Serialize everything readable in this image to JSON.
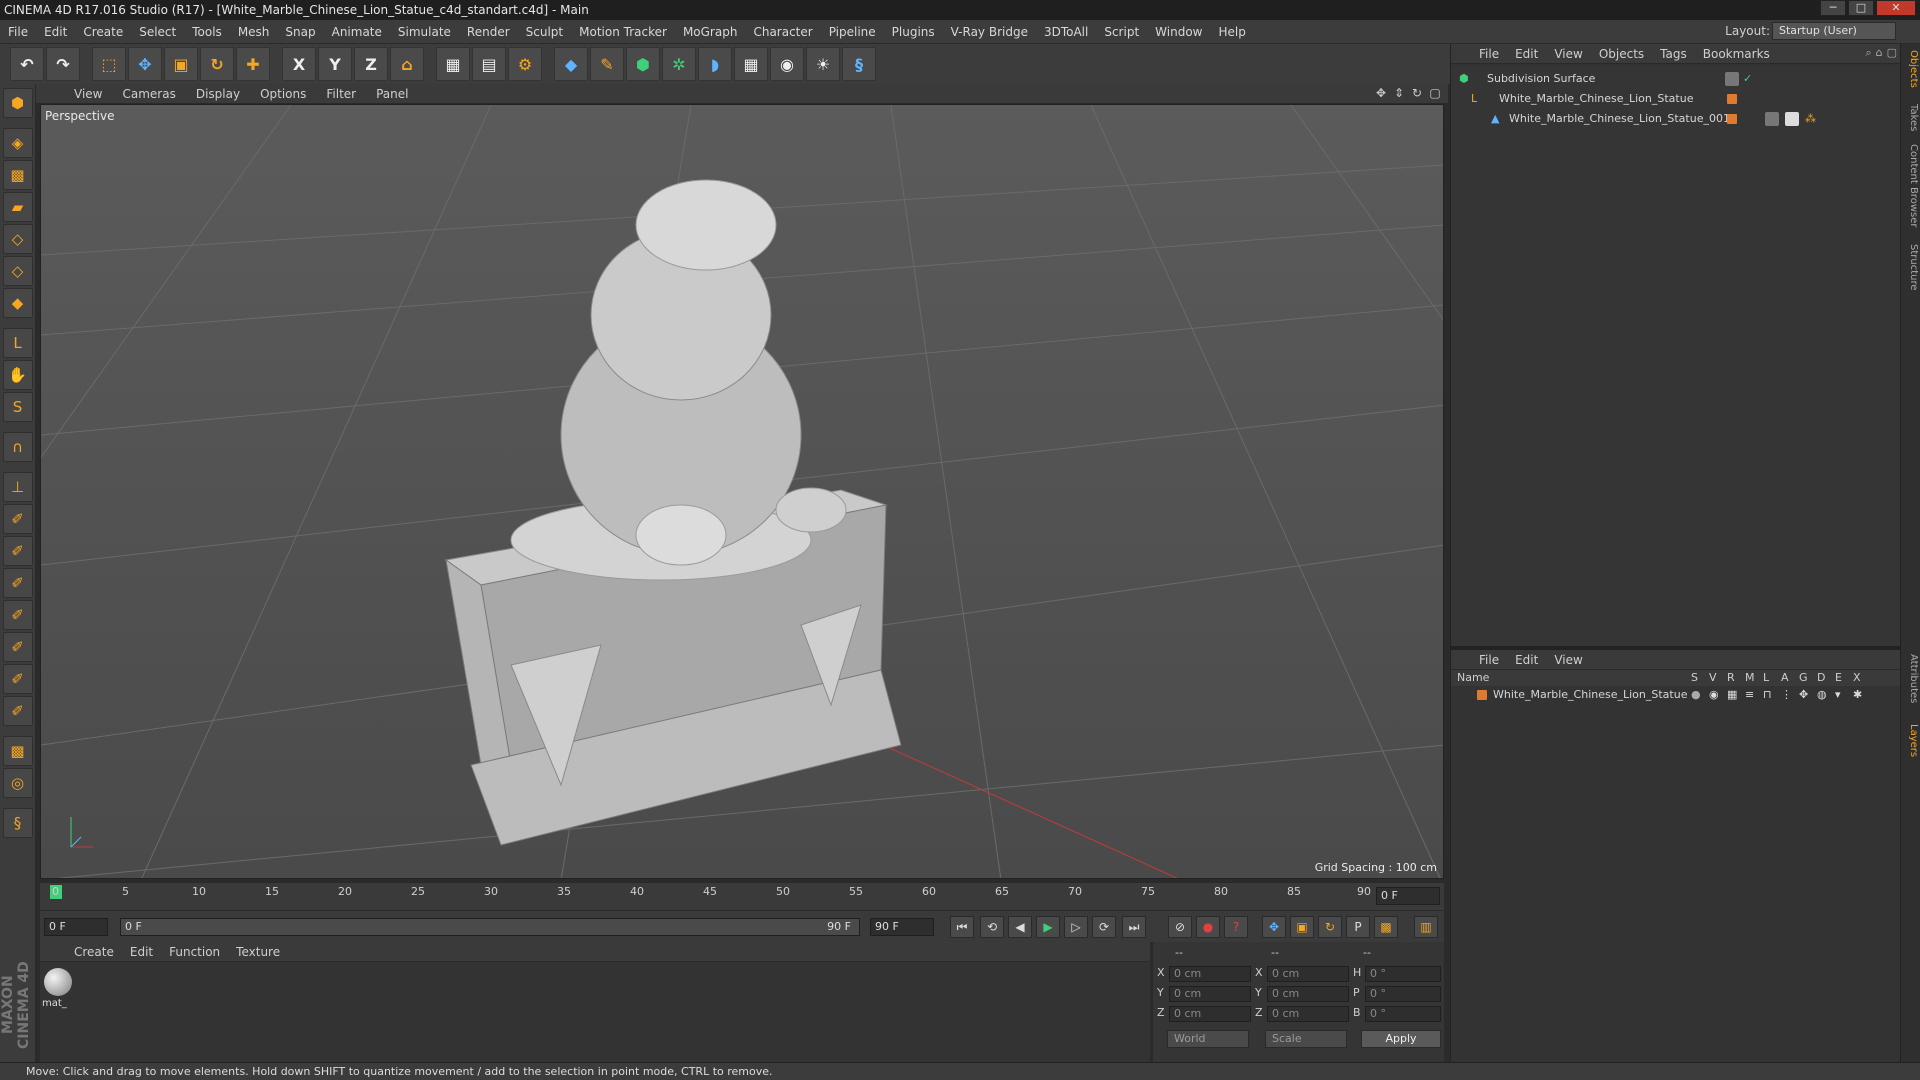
{
  "window": {
    "title": "CINEMA 4D R17.016 Studio (R17) - [White_Marble_Chinese_Lion_Statue_c4d_standart.c4d] - Main",
    "controls": [
      "─",
      "□",
      "✕"
    ]
  },
  "menubar": {
    "items": [
      "File",
      "Edit",
      "Create",
      "Select",
      "Tools",
      "Mesh",
      "Snap",
      "Animate",
      "Simulate",
      "Render",
      "Sculpt",
      "Motion Tracker",
      "MoGraph",
      "Character",
      "Pipeline",
      "Plugins",
      "V-Ray Bridge",
      "3DToAll",
      "Script",
      "Window",
      "Help"
    ],
    "layout_label": "Layout:",
    "layout_value": "Startup (User)"
  },
  "toolbar": {
    "icons": [
      "undo-icon",
      "redo-icon",
      "live-selection-icon",
      "move-icon",
      "scale-icon",
      "rotate-icon",
      "add-object-icon",
      "x-axis-icon",
      "y-axis-icon",
      "z-axis-icon",
      "coordinate-system-icon",
      "render-view-icon",
      "render-picture-viewer-icon",
      "edit-render-settings-icon",
      "cube-icon",
      "pen-spline-icon",
      "subdivision-icon",
      "array-icon",
      "deformer-icon",
      "floor-icon",
      "camera-icon",
      "light-icon",
      "python-icon"
    ],
    "axis_labels": [
      "X",
      "Y",
      "Z"
    ]
  },
  "viewport": {
    "menu": [
      "View",
      "Cameras",
      "Display",
      "Options",
      "Filter",
      "Panel"
    ],
    "label": "Perspective",
    "grid_spacing": "Grid Spacing : 100 cm"
  },
  "timeline": {
    "ticks": [
      "0",
      "5",
      "10",
      "15",
      "20",
      "25",
      "30",
      "35",
      "40",
      "45",
      "50",
      "55",
      "60",
      "65",
      "70",
      "75",
      "80",
      "85",
      "90"
    ],
    "current_frame": "0 F"
  },
  "transport": {
    "start_frame": "0 F",
    "range_start": "0 F",
    "range_end": "90 F",
    "end_frame": "90 F",
    "buttons": [
      "⏮",
      "⟲",
      "◀",
      "▶",
      "▷",
      "⟳",
      "⏭"
    ]
  },
  "material_manager": {
    "menu": [
      "Create",
      "Edit",
      "Function",
      "Texture"
    ],
    "materials": [
      {
        "label": "mat_"
      }
    ]
  },
  "coordinates": {
    "header": [
      "--",
      "--",
      "--"
    ],
    "rows": [
      {
        "a": "X",
        "av": "0 cm",
        "b": "X",
        "bv": "0 cm",
        "c": "H",
        "cv": "0 °"
      },
      {
        "a": "Y",
        "av": "0 cm",
        "b": "Y",
        "bv": "0 cm",
        "c": "P",
        "cv": "0 °"
      },
      {
        "a": "Z",
        "av": "0 cm",
        "b": "Z",
        "bv": "0 cm",
        "c": "B",
        "cv": "0 °"
      }
    ],
    "world": "World",
    "scale": "Scale",
    "apply": "Apply"
  },
  "object_manager": {
    "menu": [
      "File",
      "Edit",
      "View",
      "Objects",
      "Tags",
      "Bookmarks"
    ],
    "objects": [
      {
        "name": "Subdivision Surface"
      },
      {
        "name": "White_Marble_Chinese_Lion_Statue"
      },
      {
        "name": "White_Marble_Chinese_Lion_Statue_001"
      }
    ]
  },
  "layer_manager": {
    "menu": [
      "File",
      "Edit",
      "View"
    ],
    "columns": [
      "Name",
      "S",
      "V",
      "R",
      "M",
      "L",
      "A",
      "G",
      "D",
      "E",
      "X"
    ],
    "layers": [
      {
        "name": "White_Marble_Chinese_Lion_Statue"
      }
    ]
  },
  "side_tabs": [
    "Objects",
    "Takes",
    "Content Browser",
    "Structure",
    "Attributes",
    "Layers"
  ],
  "brand": "MAXON CINEMA 4D",
  "status": "Move: Click and drag to move elements. Hold down SHIFT to quantize movement / add to the selection in point mode, CTRL to remove.",
  "colors": {
    "accent": "#f5a623",
    "layer": "#e07a2f",
    "playhead": "#3fd07a"
  }
}
